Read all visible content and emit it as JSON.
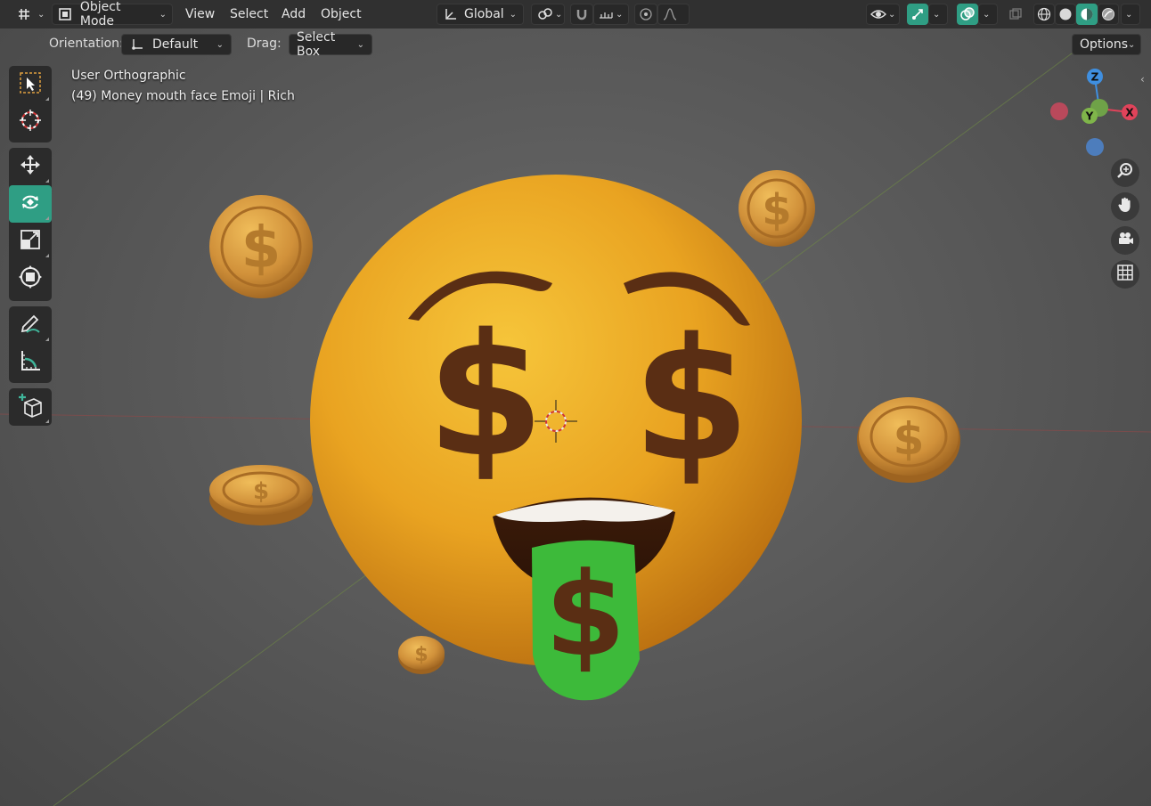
{
  "header": {
    "editor_type_icon": "grid-editor-icon",
    "mode_label": "Object Mode",
    "menu": [
      "View",
      "Select",
      "Add",
      "Object"
    ],
    "transform_orientation": "Global"
  },
  "tool_settings": {
    "orientation_label": "Orientation:",
    "orientation_value": "Default",
    "drag_label": "Drag:",
    "drag_value": "Select Box",
    "options_label": "Options"
  },
  "toolbar": {
    "tools": [
      "select-box",
      "cursor",
      "move",
      "rotate",
      "scale",
      "transform",
      "annotate",
      "measure",
      "add-cube"
    ],
    "active_tool": "rotate"
  },
  "viewport_overlay": {
    "view_name": "User Orthographic",
    "object_info": "(49) Money mouth face Emoji | Rich"
  },
  "gizmo": {
    "z_label": "Z",
    "y_label": "Y",
    "x_label": "X"
  },
  "colors": {
    "accent": "#2f9e84",
    "emoji_yellow": "#e8a21f",
    "brown": "#5a2e14",
    "tongue_green": "#3dba3a",
    "coin_gold": "#d39a3a",
    "axis_x": "#e0435a",
    "axis_y": "#7fb54a",
    "axis_z": "#3f8fe0"
  }
}
